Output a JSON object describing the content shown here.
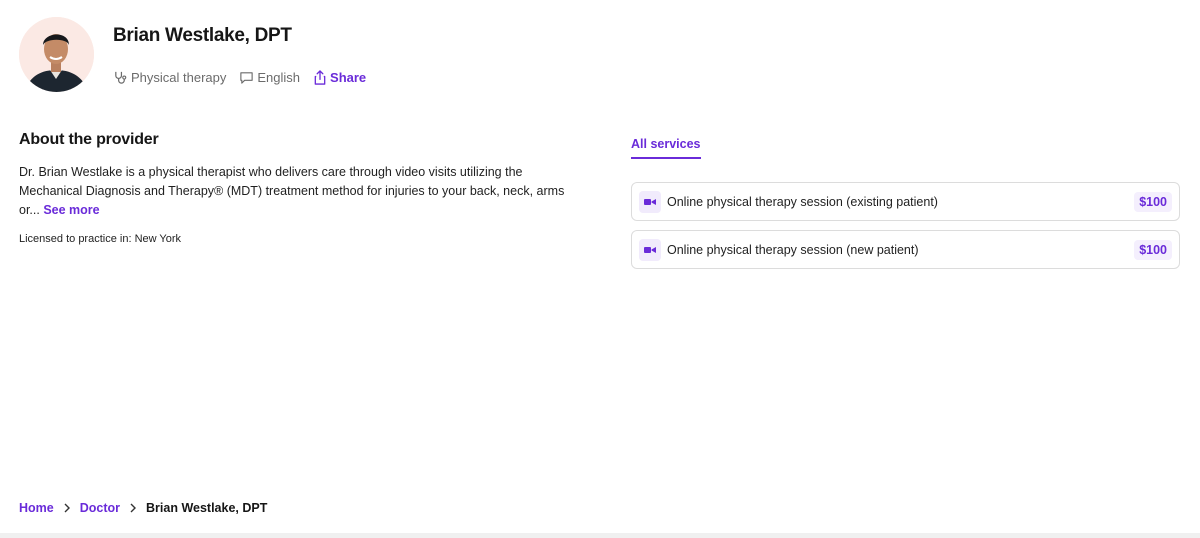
{
  "provider": {
    "name": "Brian Westlake, DPT",
    "specialty": "Physical therapy",
    "language": "English",
    "share_label": "Share"
  },
  "about": {
    "title": "About the provider",
    "body": "Dr. Brian Westlake is a physical therapist who delivers care through video visits utilizing the Mechanical Diagnosis and Therapy® (MDT) treatment method for injuries to your back, neck, arms or...",
    "see_more": "See more",
    "licensed": "Licensed to practice in: New York"
  },
  "services": {
    "tab_label": "All services",
    "items": [
      {
        "label": "Online physical therapy session (existing patient)",
        "price": "$100"
      },
      {
        "label": "Online physical therapy session (new patient)",
        "price": "$100"
      }
    ]
  },
  "breadcrumb": {
    "items": [
      "Home",
      "Doctor"
    ],
    "current": "Brian Westlake, DPT"
  },
  "colors": {
    "accent": "#6a2bd9",
    "border": "#dcdcdc",
    "text": "#1f1f1f"
  },
  "icons": {
    "specialty": "stethoscope-icon",
    "language": "chat-bubble-icon",
    "share": "share-icon",
    "service": "video-camera-icon",
    "breadcrumb_separator": "chevron-right-icon"
  }
}
